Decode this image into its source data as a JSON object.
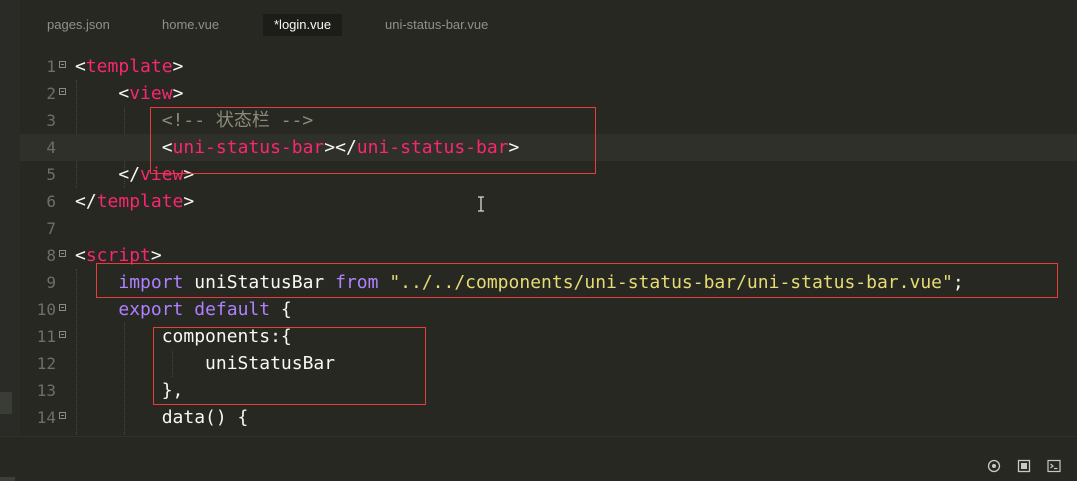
{
  "tabs": [
    {
      "label": "pages.json",
      "active": false
    },
    {
      "label": "home.vue",
      "active": false
    },
    {
      "label": "*login.vue",
      "active": true
    },
    {
      "label": "uni-status-bar.vue",
      "active": false
    }
  ],
  "lines": [
    {
      "n": "1",
      "fold": true
    },
    {
      "n": "2",
      "fold": true
    },
    {
      "n": "3",
      "fold": false
    },
    {
      "n": "4",
      "fold": false
    },
    {
      "n": "5",
      "fold": false
    },
    {
      "n": "6",
      "fold": false
    },
    {
      "n": "7",
      "fold": false
    },
    {
      "n": "8",
      "fold": true
    },
    {
      "n": "9",
      "fold": false
    },
    {
      "n": "10",
      "fold": true
    },
    {
      "n": "11",
      "fold": true
    },
    {
      "n": "12",
      "fold": false
    },
    {
      "n": "13",
      "fold": false
    },
    {
      "n": "14",
      "fold": true
    }
  ],
  "code": {
    "l1": {
      "open": "<",
      "name": "template",
      "close": ">"
    },
    "l2": {
      "indent": "    ",
      "open": "<",
      "name": "view",
      "close": ">"
    },
    "l3": {
      "indent": "        ",
      "comment": "<!-- 状态栏 -->"
    },
    "l4": {
      "indent": "        ",
      "open": "<",
      "name": "uni-status-bar",
      "mid": "></",
      "name2": "uni-status-bar",
      "close": ">"
    },
    "l5": {
      "indent": "    ",
      "open": "</",
      "name": "view",
      "close": ">"
    },
    "l6": {
      "open": "</",
      "name": "template",
      "close": ">"
    },
    "l8": {
      "open": "<",
      "name": "script",
      "close": ">"
    },
    "l9": {
      "indent": "    ",
      "kw1": "import",
      "ident": " uniStatusBar ",
      "kw2": "from",
      "sp": " ",
      "str": "\"../../components/uni-status-bar/uni-status-bar.vue\"",
      "end": ";"
    },
    "l10": {
      "indent": "    ",
      "kw1": "export",
      "sp": " ",
      "kw2": "default",
      "rest": " {"
    },
    "l11": {
      "indent": "        ",
      "text": "components:{"
    },
    "l12": {
      "indent": "            ",
      "text": "uniStatusBar"
    },
    "l13": {
      "indent": "        ",
      "text": "},"
    },
    "l14": {
      "indent": "        ",
      "text": "data() {"
    }
  },
  "status_icons": [
    "record-icon",
    "stop-icon",
    "terminal-icon"
  ],
  "colors": {
    "background": "#272822",
    "tag": "#f92672",
    "keyword": "#ae81ff",
    "string": "#e6db74",
    "comment": "#8d8a7a",
    "highlight_box": "#e83c3c"
  }
}
